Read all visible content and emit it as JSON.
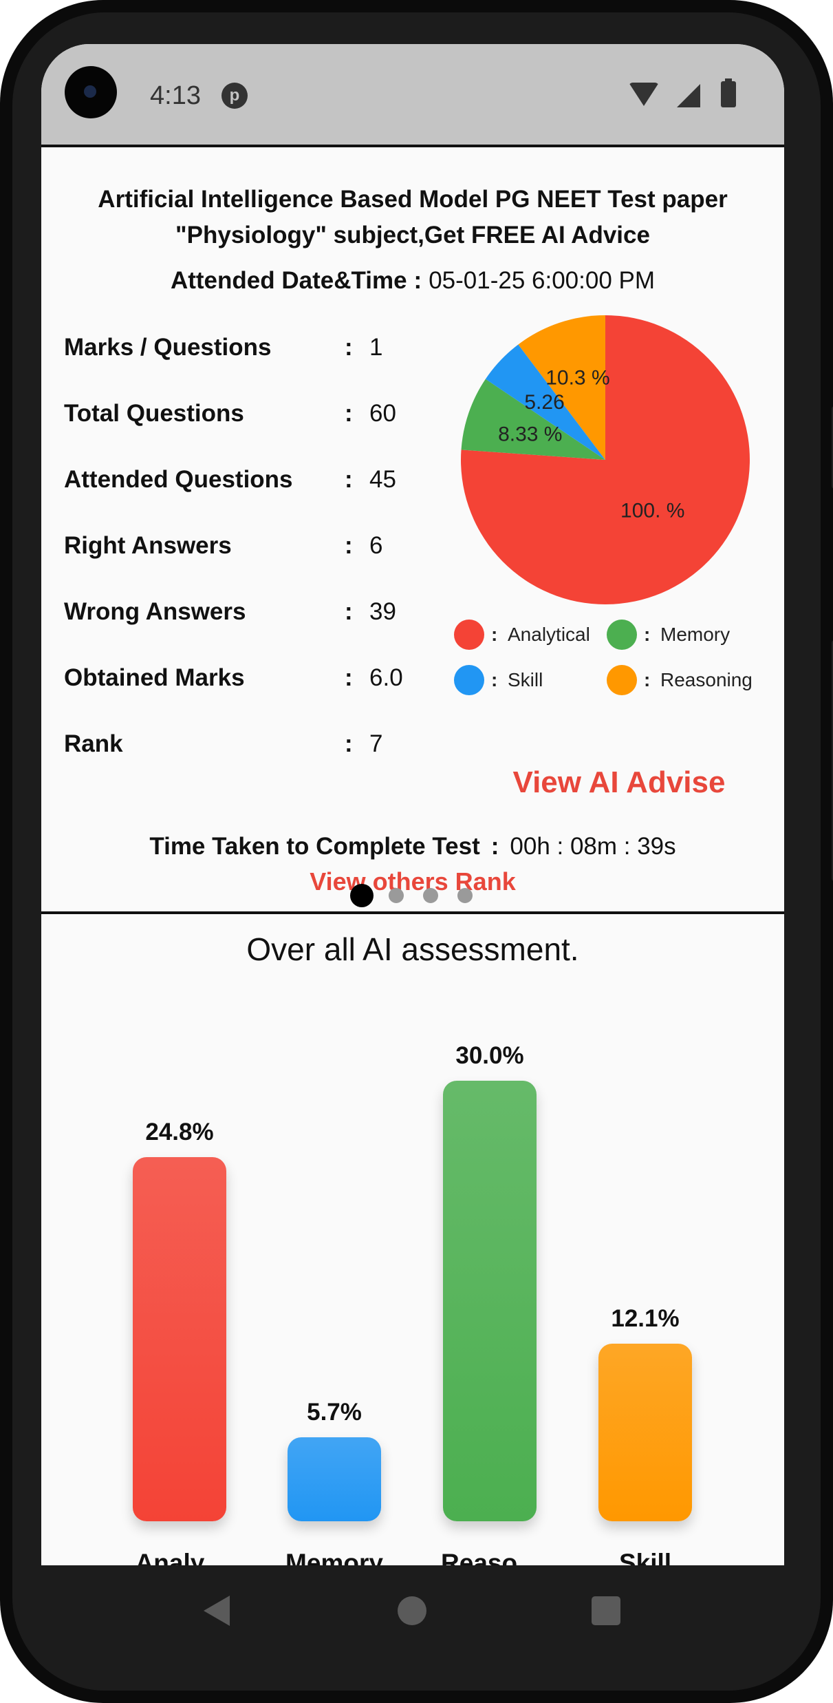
{
  "status_bar": {
    "time": "4:13",
    "notification_icon": "app-notification-icon"
  },
  "test": {
    "title_line1": "Artificial Intelligence Based Model PG NEET Test paper",
    "title_line2": "\"Physiology\" subject,Get FREE AI Advice",
    "attended_label": "Attended Date&Time",
    "attended_value": "05-01-25 6:00:00 PM",
    "separator": ":"
  },
  "stats": [
    {
      "label": "Marks / Questions",
      "value": "1"
    },
    {
      "label": "Total Questions",
      "value": "60"
    },
    {
      "label": "Attended Questions",
      "value": "45"
    },
    {
      "label": "Right Answers",
      "value": "6"
    },
    {
      "label": "Wrong Answers",
      "value": "39"
    },
    {
      "label": "Obtained Marks",
      "value": "6.0"
    },
    {
      "label": "Rank",
      "value": "7"
    }
  ],
  "pie_chart": {
    "slices": [
      {
        "name": "Analytical",
        "value": 76.11,
        "label": "100. %",
        "color": "#f44336"
      },
      {
        "name": "Memory",
        "value": 8.33,
        "label": "8.33 %",
        "color": "#4caf50"
      },
      {
        "name": "Skill",
        "value": 5.26,
        "label": "5.26",
        "color": "#2196f3"
      },
      {
        "name": "Reasoning",
        "value": 10.3,
        "label": "10.3 %",
        "color": "#ff9800"
      }
    ],
    "legend": [
      {
        "label": "Analytical",
        "color": "#f44336"
      },
      {
        "label": "Memory",
        "color": "#4caf50"
      },
      {
        "label": "Skill",
        "color": "#2196f3"
      },
      {
        "label": "Reasoning",
        "color": "#ff9800"
      }
    ]
  },
  "actions": {
    "view_ai_advise": "View AI Advise",
    "view_others_rank": "View others Rank"
  },
  "time_taken": {
    "label": "Time Taken to Complete Test",
    "value": "00h : 08m : 39s"
  },
  "pager": {
    "count": 4,
    "active": 0
  },
  "assessment": {
    "title": "Over all AI assessment."
  },
  "chart_data": {
    "type": "bar",
    "categories": [
      "Analy...",
      "Memory",
      "Reaso...",
      "Skill"
    ],
    "values": [
      24.8,
      5.7,
      30.0,
      12.1
    ],
    "value_labels": [
      "24.8%",
      "5.7%",
      "30.0%",
      "12.1%"
    ],
    "colors": [
      "#f44336",
      "#2196f3",
      "#4caf50",
      "#ff9800"
    ],
    "title": "Over all AI assessment.",
    "xlabel": "",
    "ylabel": "",
    "ylim": [
      0,
      30
    ],
    "grid": false
  }
}
